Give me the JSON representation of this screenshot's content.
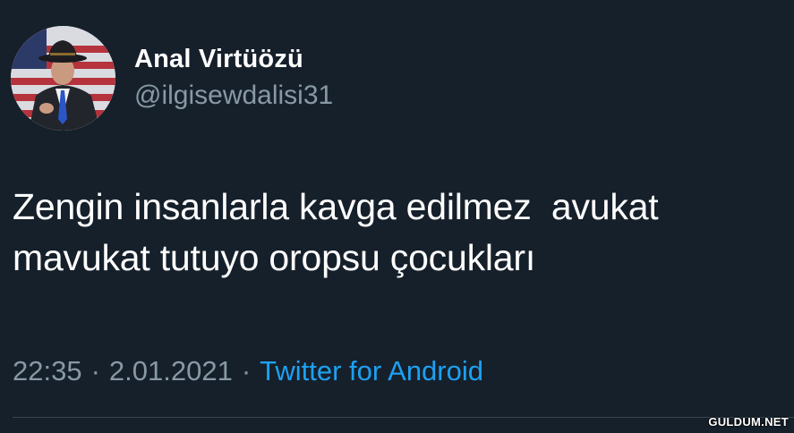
{
  "user": {
    "display_name": "Anal Virtüözü",
    "handle": "@ilgisewdalisi31",
    "avatar_icon": "profile-photo"
  },
  "tweet": {
    "text": "Zengin insanlarla kavga edilmez  avukat\nmavukat tutuyo oropsu çocukları",
    "time": "22:35",
    "date": "2.01.2021",
    "separator": "·",
    "source": "Twitter for Android"
  },
  "watermark": "GULDUM.NET",
  "colors": {
    "background": "#16202b",
    "text": "#ffffff",
    "secondary": "#8899a6",
    "link": "#1da1f2",
    "divider": "#38444d"
  }
}
